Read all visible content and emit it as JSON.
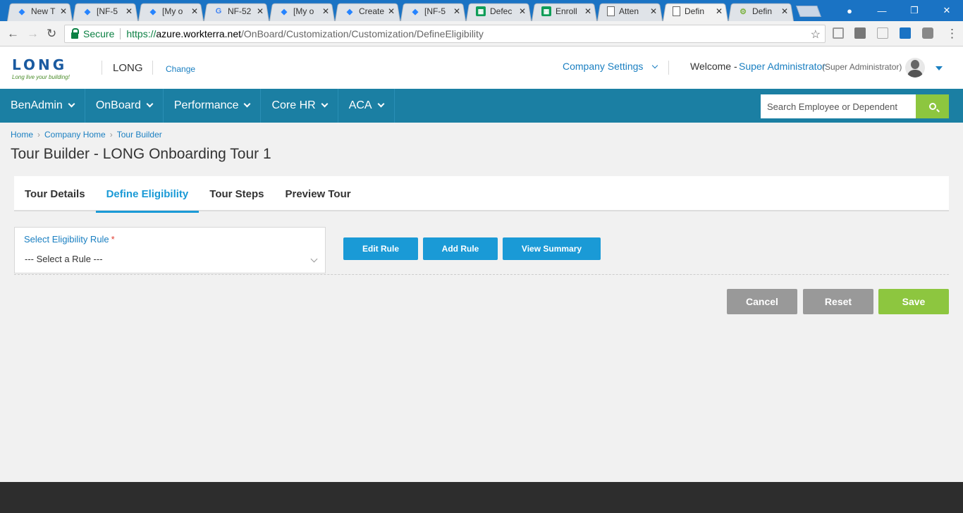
{
  "browser": {
    "tabs": [
      {
        "icon": "jira-icon",
        "label": "New T"
      },
      {
        "icon": "jira-icon",
        "label": "[NF-5"
      },
      {
        "icon": "jira-icon",
        "label": "[My o"
      },
      {
        "icon": "google-icon",
        "label": "NF-52"
      },
      {
        "icon": "jira-icon",
        "label": "[My o"
      },
      {
        "icon": "jira-icon",
        "label": "Create"
      },
      {
        "icon": "jira-icon",
        "label": "[NF-5"
      },
      {
        "icon": "sheets-icon",
        "label": "Defec"
      },
      {
        "icon": "sheets-icon",
        "label": "Enroll"
      },
      {
        "icon": "document-icon",
        "label": "Atten"
      },
      {
        "icon": "document-icon",
        "label": "Defin",
        "active": true
      },
      {
        "icon": "gear-icon",
        "label": "Defin"
      }
    ],
    "secure_label": "Secure",
    "url_scheme": "https://",
    "url_host": "azure.workterra.net",
    "url_path": "/OnBoard/Customization/Customization/DefineEligibility"
  },
  "header": {
    "logo_text": "LONG",
    "logo_tagline": "Long live your building!",
    "company_name": "LONG",
    "change_link": "Change",
    "company_settings": "Company Settings",
    "welcome": "Welcome -",
    "user_name": "Super Administrator",
    "user_role": "(Super Administrator)"
  },
  "nav": {
    "items": [
      "BenAdmin",
      "OnBoard",
      "Performance",
      "Core HR",
      "ACA"
    ],
    "search_placeholder": "Search Employee or Dependent"
  },
  "breadcrumb": [
    "Home",
    "Company Home",
    "Tour Builder"
  ],
  "page_title": "Tour Builder - LONG Onboarding Tour 1",
  "tabs": [
    {
      "label": "Tour Details"
    },
    {
      "label": "Define Eligibility",
      "active": true
    },
    {
      "label": "Tour Steps"
    },
    {
      "label": "Preview Tour"
    }
  ],
  "eligibility": {
    "label": "Select Eligibility Rule",
    "required_mark": "*",
    "selected_value": "--- Select a Rule ---"
  },
  "rule_buttons": {
    "edit": "Edit Rule",
    "add": "Add Rule",
    "summary": "View Summary"
  },
  "actions": {
    "cancel": "Cancel",
    "reset": "Reset",
    "save": "Save"
  },
  "colors": {
    "nav_bg": "#1b7fa3",
    "accent_blue": "#1a9ad6",
    "accent_green": "#8dc63f",
    "button_gray": "#999999"
  }
}
